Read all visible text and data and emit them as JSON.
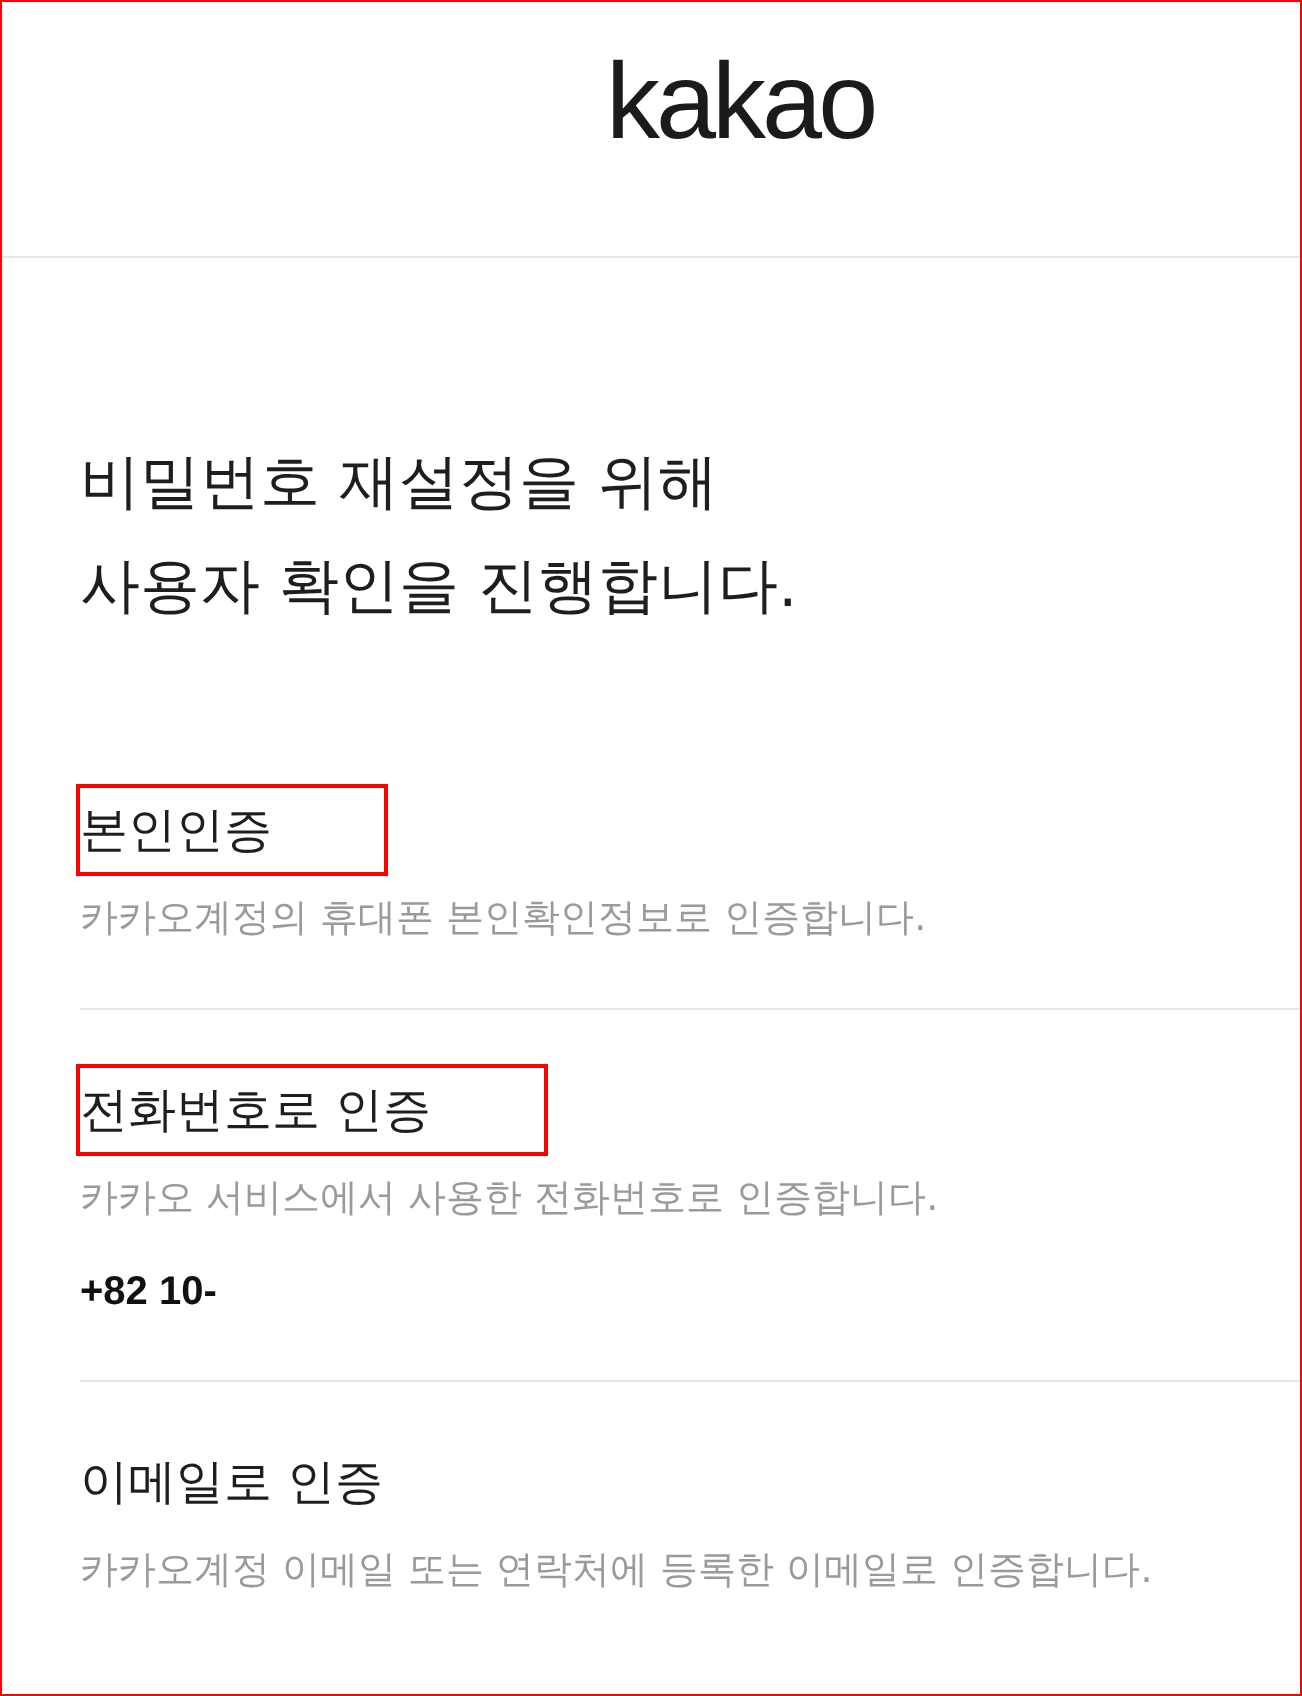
{
  "header": {
    "logo": "kakao"
  },
  "heading_lines": [
    "비밀번호 재설정을 위해",
    "사용자 확인을 진행합니다."
  ],
  "options": [
    {
      "title": "본인인증",
      "description": "카카오계정의 휴대폰 본인확인정보로 인증합니다.",
      "highlighted": true
    },
    {
      "title": "전화번호로 인증",
      "description": "카카오 서비스에서 사용한 전화번호로 인증합니다.",
      "phone": "+82 10-",
      "highlighted": true
    },
    {
      "title": "이메일로 인증",
      "description": "카카오계정 이메일 또는 연락처에 등록한 이메일로 인증합니다.",
      "highlighted": false
    }
  ]
}
